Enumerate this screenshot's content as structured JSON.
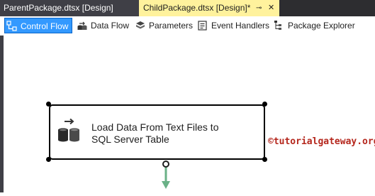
{
  "tabs": [
    {
      "label": "ParentPackage.dtsx [Design]",
      "active": false
    },
    {
      "label": "ChildPackage.dtsx [Design]*",
      "active": true
    }
  ],
  "tab_icons": {
    "pin": "pin-icon",
    "close": "close-icon"
  },
  "designer_tabs": [
    {
      "label": "Control Flow",
      "icon": "control-flow-icon",
      "active": true
    },
    {
      "label": "Data Flow",
      "icon": "data-flow-icon",
      "active": false
    },
    {
      "label": "Parameters",
      "icon": "parameters-icon",
      "active": false
    },
    {
      "label": "Event Handlers",
      "icon": "event-handlers-icon",
      "active": false
    },
    {
      "label": "Package Explorer",
      "icon": "package-explorer-icon",
      "active": false
    }
  ],
  "task": {
    "title_line1": "Load Data From Text Files to",
    "title_line2": "SQL Server Table",
    "icon": "data-flow-task-icon"
  },
  "watermark": "©tutorialgateway.org",
  "colors": {
    "active_tab_bg": "#fff29d",
    "selected_designer_tab": "#3399ff",
    "connector_green": "#6ab187",
    "watermark_red": "#b5271d"
  }
}
